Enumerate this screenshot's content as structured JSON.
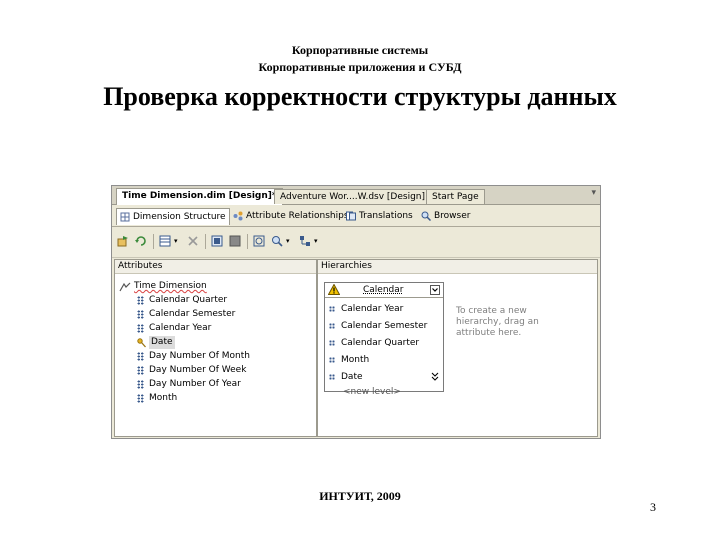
{
  "slide": {
    "header_line1": "Корпоративные системы",
    "header_line2": "Корпоративные приложения и СУБД",
    "title": "Проверка корректности структуры данных",
    "footer": "ИНТУИТ, 2009",
    "page_number": "3"
  },
  "screenshot": {
    "doc_tabs": [
      {
        "label": "Time Dimension.dim [Design]*",
        "active": true
      },
      {
        "label": "Adventure Wor....W.dsv [Design]",
        "active": false
      },
      {
        "label": "Start Page",
        "active": false
      }
    ],
    "pin_symbol": "▾",
    "designer_tabs": [
      {
        "label": "Dimension Structure",
        "icon": "dimension-structure-icon",
        "active": true
      },
      {
        "label": "Attribute Relationships",
        "icon": "relationships-icon",
        "active": false
      },
      {
        "label": "Translations",
        "icon": "translations-icon",
        "active": false
      },
      {
        "label": "Browser",
        "icon": "browser-icon",
        "active": false
      }
    ],
    "attributes_pane": {
      "header": "Attributes",
      "root": "Time Dimension",
      "items": [
        "Calendar Quarter",
        "Calendar Semester",
        "Calendar Year",
        "Date",
        "Day Number Of Month",
        "Day Number Of Week",
        "Day Number Of Year",
        "Month"
      ],
      "selected_item": "Date"
    },
    "hierarchies_pane": {
      "header": "Hierarchies",
      "hierarchy": {
        "name": "Calendar",
        "levels": [
          "Calendar Year",
          "Calendar Semester",
          "Calendar Quarter",
          "Month",
          "Date"
        ],
        "new_level": "<new level>"
      },
      "hint": "To create a new hierarchy, drag an attribute here."
    },
    "colors": {
      "chrome": "#ece9d8",
      "warning": "#f2c200",
      "attribute_icon": "#3a5a8c"
    }
  }
}
